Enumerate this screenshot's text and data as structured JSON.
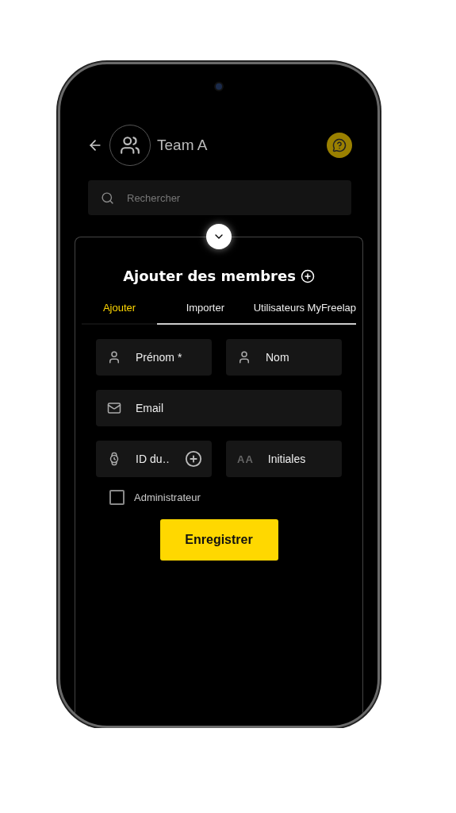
{
  "header": {
    "title": "Team A"
  },
  "search": {
    "placeholder": "Rechercher"
  },
  "sheet": {
    "title": "Ajouter des membres",
    "tabs": [
      {
        "label": "Ajouter",
        "selected": true
      },
      {
        "label": "Importer",
        "selected": false
      },
      {
        "label": "Utilisateurs MyFreelap",
        "selected": false
      }
    ],
    "fields": [
      {
        "kind": "person",
        "placeholder": "Prénom *"
      },
      {
        "kind": "person",
        "placeholder": "Nom"
      },
      {
        "kind": "email",
        "placeholder": "Email"
      },
      {
        "kind": "device",
        "placeholder": "ID du…"
      },
      {
        "kind": "initials",
        "placeholder": "Initiales",
        "icon_text": "AA"
      }
    ],
    "admin": {
      "label": "Administrateur",
      "checked": false
    },
    "save_button": "Enregistrer"
  }
}
